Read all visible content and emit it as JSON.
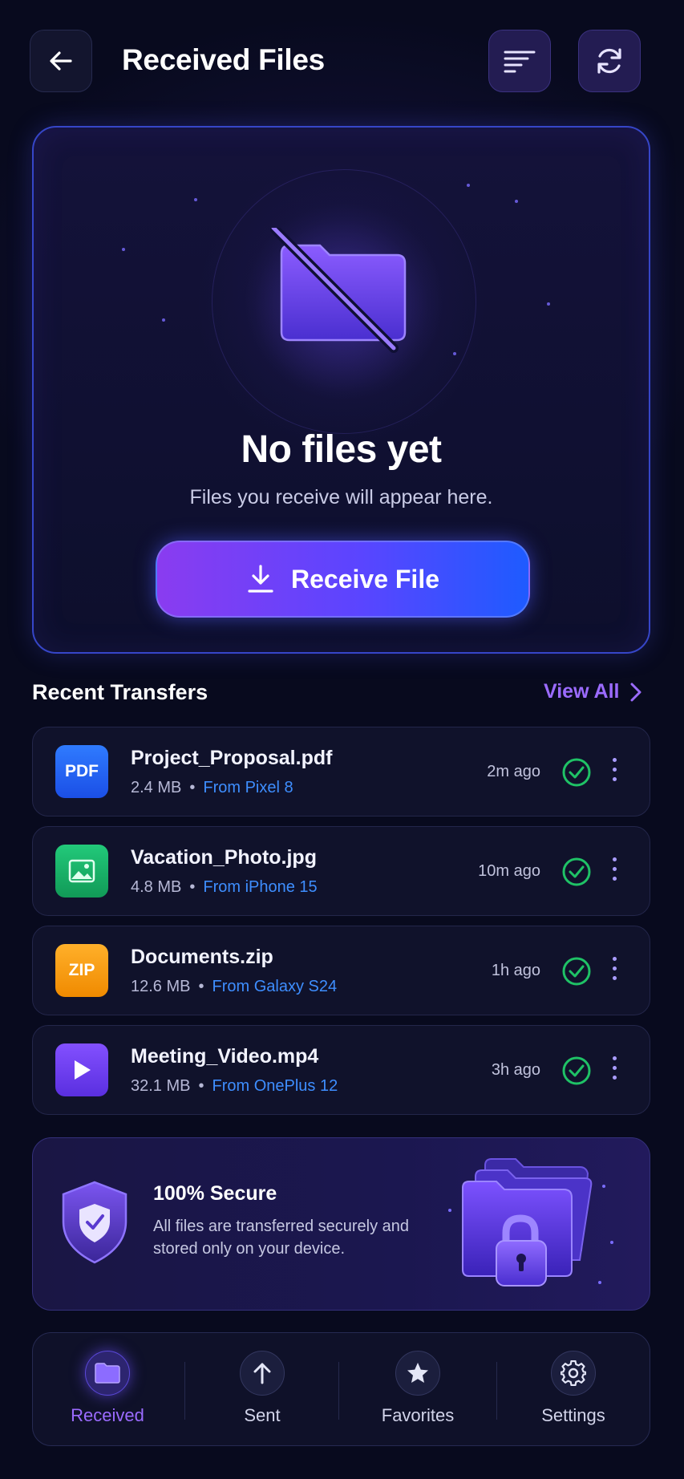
{
  "header": {
    "title": "Received Files"
  },
  "empty_state": {
    "title": "No files yet",
    "subtitle": "Files you receive will appear here.",
    "button_label": "Receive File"
  },
  "recent": {
    "title": "Recent Transfers",
    "view_all_label": "View All",
    "items": [
      {
        "icon_text": "PDF",
        "icon": "pdf-icon",
        "color": "#1f5eff",
        "name": "Project_Proposal.pdf",
        "size": "2.4 MB",
        "separator": "•",
        "source": "From Pixel 8",
        "time": "2m ago"
      },
      {
        "icon_text": "",
        "icon": "image-icon",
        "color": "#18b06a",
        "name": "Vacation_Photo.jpg",
        "size": "4.8 MB",
        "separator": "•",
        "source": "From iPhone 15",
        "time": "10m ago"
      },
      {
        "icon_text": "ZIP",
        "icon": "zip-icon",
        "color": "#ff9a12",
        "name": "Documents.zip",
        "size": "12.6 MB",
        "separator": "•",
        "source": "From Galaxy S24",
        "time": "1h ago"
      },
      {
        "icon_text": "",
        "icon": "play-icon",
        "color": "#6b3cf0",
        "name": "Meeting_Video.mp4",
        "size": "32.1 MB",
        "separator": "•",
        "source": "From OnePlus 12",
        "time": "3h ago"
      }
    ]
  },
  "secure": {
    "title": "100% Secure",
    "text": "All files are transferred securely and stored only on your device."
  },
  "nav": {
    "items": [
      {
        "label": "Received",
        "icon": "folder-icon",
        "active": true
      },
      {
        "label": "Sent",
        "icon": "arrow-up-icon",
        "active": false
      },
      {
        "label": "Favorites",
        "icon": "star-icon",
        "active": false
      },
      {
        "label": "Settings",
        "icon": "gear-icon",
        "active": false
      }
    ]
  },
  "colors": {
    "background": "#080a1e",
    "accent": "#9b6bff",
    "link": "#3e8eff",
    "success": "#1fc266"
  }
}
